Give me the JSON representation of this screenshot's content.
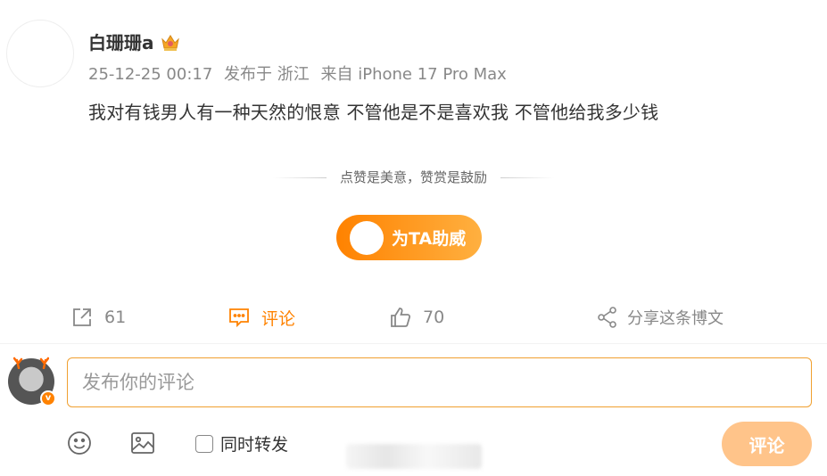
{
  "post": {
    "author": "白珊珊a",
    "meta": {
      "time": "25-12-25 00:17",
      "location": "发布于 浙江",
      "source": "来自 iPhone 17 Pro Max"
    },
    "text": "我对有钱男人有一种天然的恨意 不管他是不是喜欢我 不管他给我多少钱"
  },
  "reward": {
    "tip": "点赞是美意，赞赏是鼓励",
    "button_label": "为TA助威"
  },
  "actions": {
    "repost_count": "61",
    "comment_label": "评论",
    "like_count": "70",
    "share_label": "分享这条博文"
  },
  "composer": {
    "placeholder": "发布你的评论",
    "forward_label": "同时转发",
    "submit_label": "评论"
  },
  "colors": {
    "accent": "#ff8200",
    "submit_disabled": "#ffc48a",
    "text_primary": "#333333",
    "text_secondary": "#888888"
  },
  "icons": [
    "crown-icon",
    "repost-icon",
    "comment-icon",
    "like-icon",
    "share-icon",
    "emoji-icon",
    "image-icon"
  ]
}
